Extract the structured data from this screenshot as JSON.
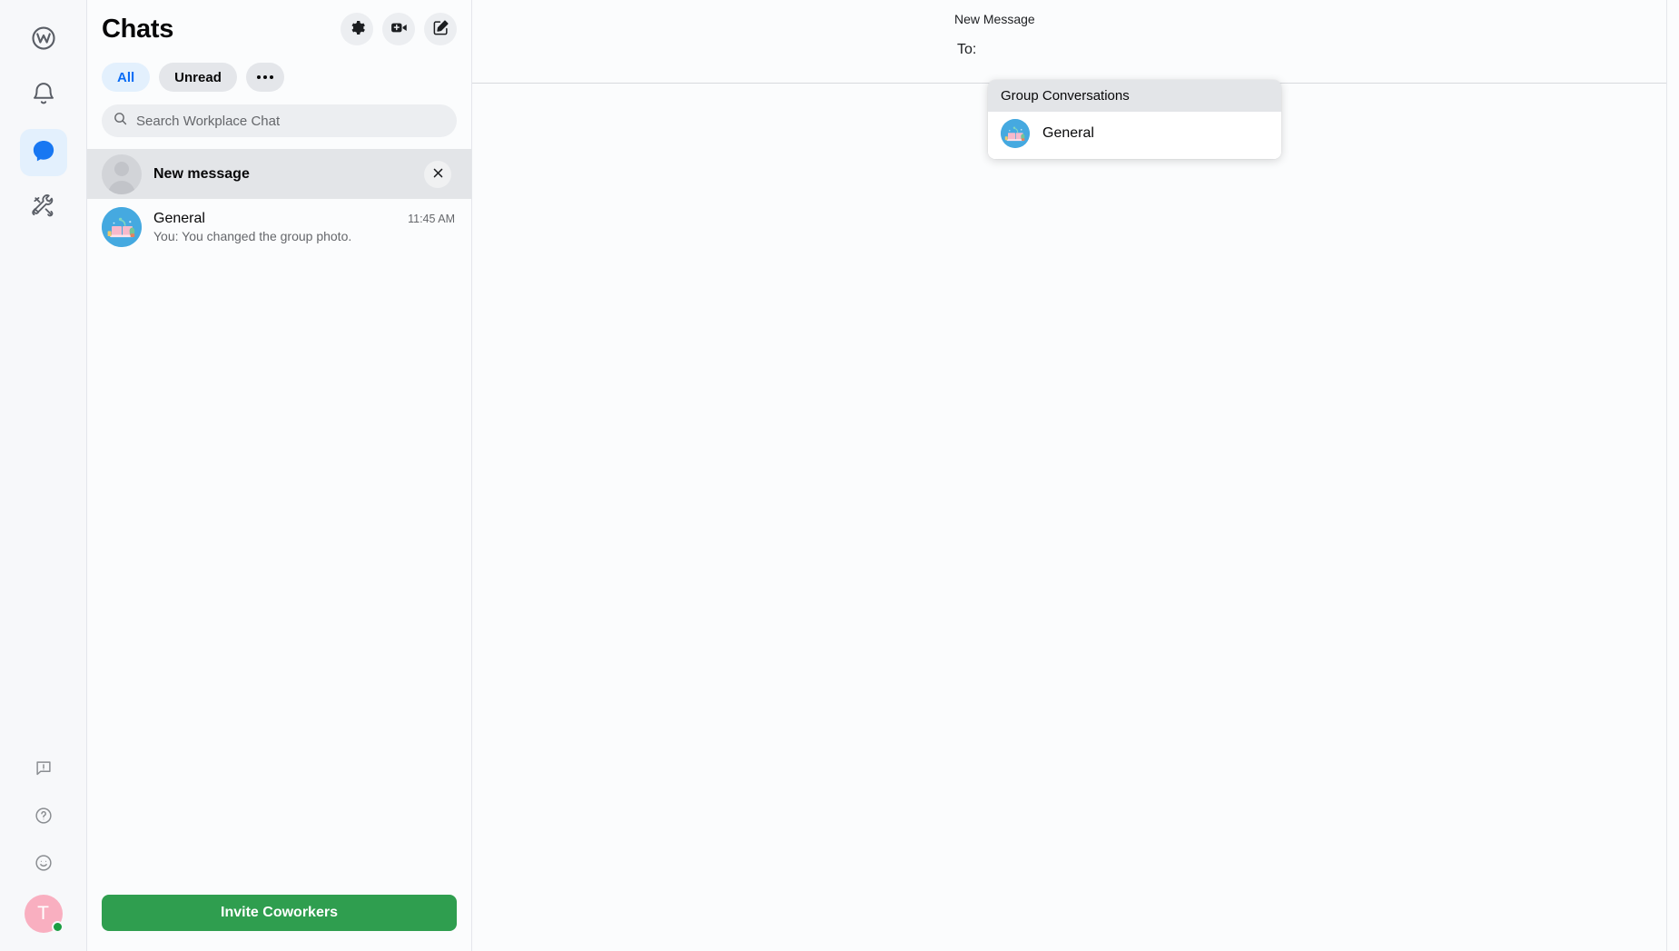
{
  "rail": {
    "items": [
      {
        "name": "workplace-home",
        "icon": "workplace-logo-icon",
        "label": "Workplace",
        "active": false
      },
      {
        "name": "notifications",
        "icon": "bell-icon",
        "label": "Notifications",
        "active": false
      },
      {
        "name": "chat",
        "icon": "chat-bubble-icon",
        "label": "Chat",
        "active": true
      },
      {
        "name": "admin-tools",
        "icon": "tools-icon",
        "label": "Admin tools",
        "active": false
      }
    ],
    "bottom_items": [
      {
        "name": "report-problem",
        "icon": "report-problem-icon",
        "label": "Report a problem"
      },
      {
        "name": "help",
        "icon": "question-circle-icon",
        "label": "Help"
      },
      {
        "name": "feedback",
        "icon": "smiley-icon",
        "label": "Give feedback"
      }
    ],
    "avatar": {
      "initial": "T",
      "color": "#f9afc0",
      "presence": "online",
      "presence_color": "#1b9e43"
    }
  },
  "chat_panel": {
    "title": "Chats",
    "header_buttons": [
      {
        "name": "settings-button",
        "icon": "gear-icon",
        "label": "Settings"
      },
      {
        "name": "new-video-call-button",
        "icon": "video-camera-plus-icon",
        "label": "New video call"
      },
      {
        "name": "new-message-button",
        "icon": "compose-icon",
        "label": "New message"
      }
    ],
    "filters": [
      {
        "label": "All",
        "selected": true
      },
      {
        "label": "Unread",
        "selected": false
      },
      {
        "label": "•••",
        "selected": false
      }
    ],
    "search": {
      "placeholder": "Search Workplace Chat",
      "value": "",
      "icon": "search-icon"
    },
    "rows": [
      {
        "type": "new-message",
        "title": "New message",
        "avatar": "generic-person-avatar",
        "close_icon": "close-icon",
        "selected": true
      },
      {
        "type": "conversation",
        "name": "General",
        "time": "11:45 AM",
        "preview": "You: You changed the group photo.",
        "avatar": "group-photo-avatar",
        "selected": false
      }
    ],
    "invite_button": {
      "label": "Invite Coworkers",
      "color": "#2f9e4f"
    }
  },
  "main_panel": {
    "header_label": "New Message",
    "to_label": "To:",
    "to_value": "",
    "to_placeholder": "",
    "suggestions": {
      "section_header": "Group Conversations",
      "items": [
        {
          "label": "General",
          "avatar": "group-photo-avatar"
        }
      ]
    }
  },
  "colors": {
    "accent_blue": "#0a6cf5",
    "active_rail_bg": "#e3f0fd",
    "pill_bg": "#e4e6ea",
    "pill_selected_bg": "#e3f0fd",
    "panel_bg": "#fbfcfd",
    "row_selected_bg": "#e3e5e8",
    "invite_green": "#2f9e4f",
    "text_primary": "#080809",
    "text_secondary": "#65676b"
  }
}
